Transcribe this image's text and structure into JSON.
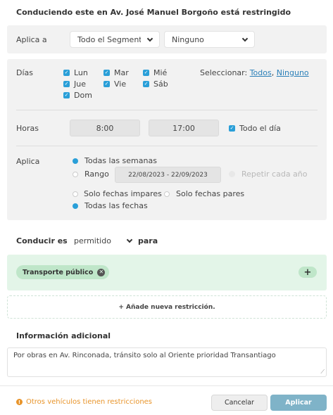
{
  "title": "Conduciendo este en Av. José Manuel Borgoño está restringido",
  "aplica_a": {
    "label": "Aplica a",
    "segment_value": "Todo el Segmento",
    "second_value": "Ninguno"
  },
  "dias": {
    "label": "Días",
    "days": [
      "Lun",
      "Mar",
      "Mié",
      "Jue",
      "Vie",
      "Sáb",
      "Dom"
    ],
    "select_label": "Seleccionar:",
    "select_all": "Todos",
    "select_none": "Ninguno"
  },
  "horas": {
    "label": "Horas",
    "start": "8:00",
    "end": "17:00",
    "all_day": "Todo el día"
  },
  "aplica": {
    "label": "Aplica",
    "all_weeks": "Todas las semanas",
    "range_label": "Rango",
    "range_value": "22/08/2023 - 22/09/2023",
    "repeat": "Repetir cada año",
    "odd_dates": "Solo fechas impares",
    "even_dates": "Solo fechas pares",
    "all_dates": "Todas las fechas"
  },
  "conducir": {
    "label": "Conducir es",
    "value": "permitido",
    "para": "para"
  },
  "chip": {
    "label": "Transporte público"
  },
  "add_restriction": "+ Añade nueva restricción.",
  "info": {
    "label": "Información adicional",
    "text": "Por obras en Av. Rinconada, tránsito solo al Oriente prioridad Transantiago"
  },
  "footer": {
    "warning": "Otros vehículos tienen restricciones",
    "cancel": "Cancelar",
    "apply": "Aplicar"
  },
  "colors": {
    "accent": "#2a9fd8",
    "warning": "#e8942a",
    "apply_btn": "#7fb3c8",
    "chip_bg": "#bfe6c9",
    "green_panel": "#e3f5e8"
  }
}
